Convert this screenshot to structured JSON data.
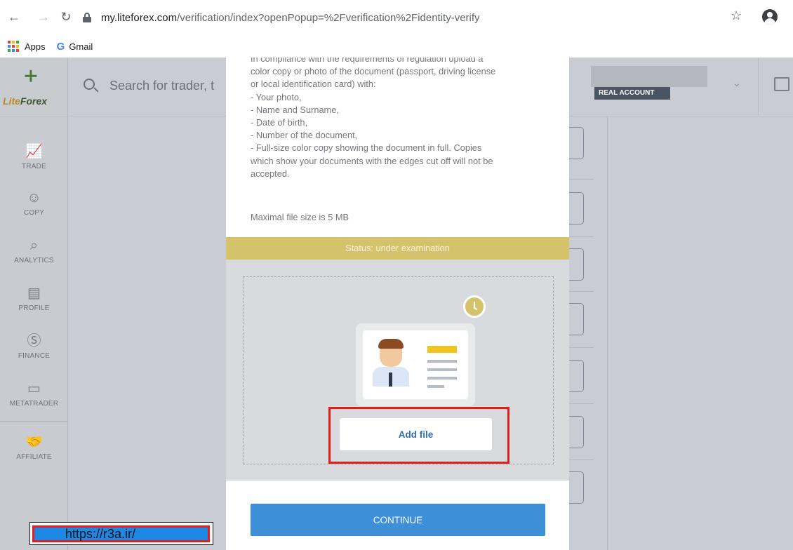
{
  "browser": {
    "url_host": "my.liteforex.com",
    "url_path": "/verification/index?openPopup=%2Fverification%2Fidentity-verify",
    "bookmarks": [
      {
        "label": "Apps",
        "icon": "apps-grid-icon"
      },
      {
        "label": "Gmail",
        "icon": "google-g-icon"
      }
    ]
  },
  "app": {
    "logo_text_lite": "Lite",
    "logo_text_forex": "Forex",
    "search_placeholder": "Search for trader, t",
    "account_badge": "REAL ACCOUNT",
    "sidebar": [
      {
        "label": "TRADE",
        "icon": "chart-icon"
      },
      {
        "label": "COPY",
        "icon": "trader-icon"
      },
      {
        "label": "ANALYTICS",
        "icon": "analytics-icon"
      },
      {
        "label": "PROFILE",
        "icon": "id-card-icon"
      },
      {
        "label": "FINANCE",
        "icon": "dollar-icon"
      },
      {
        "label": "METATRADER",
        "icon": "window-icon"
      },
      {
        "label": "AFFILIATE",
        "icon": "handshake-icon"
      }
    ]
  },
  "modal": {
    "intro_cut": "In compliance with the requirements of regulation upload a",
    "intro_lines": [
      "color copy or photo of the document (passport, driving license",
      "or local identification card) with:",
      "- Your photo,",
      "- Name and Surname,",
      "- Date of birth,",
      "- Number of the document,",
      "- Full-size color copy showing the document in full. Copies",
      "which show your documents with the edges cut off will not be",
      "accepted."
    ],
    "max_size": "Maximal file size is 5 MB",
    "status": "Status: under examination",
    "add_file": "Add file",
    "continue": "CONTINUE"
  },
  "watermark": "https://r3a.ir/",
  "colors": {
    "status_bar": "#d4c36a",
    "continue_button": "#3d8fd8",
    "highlight_border": "#e21d1d"
  }
}
